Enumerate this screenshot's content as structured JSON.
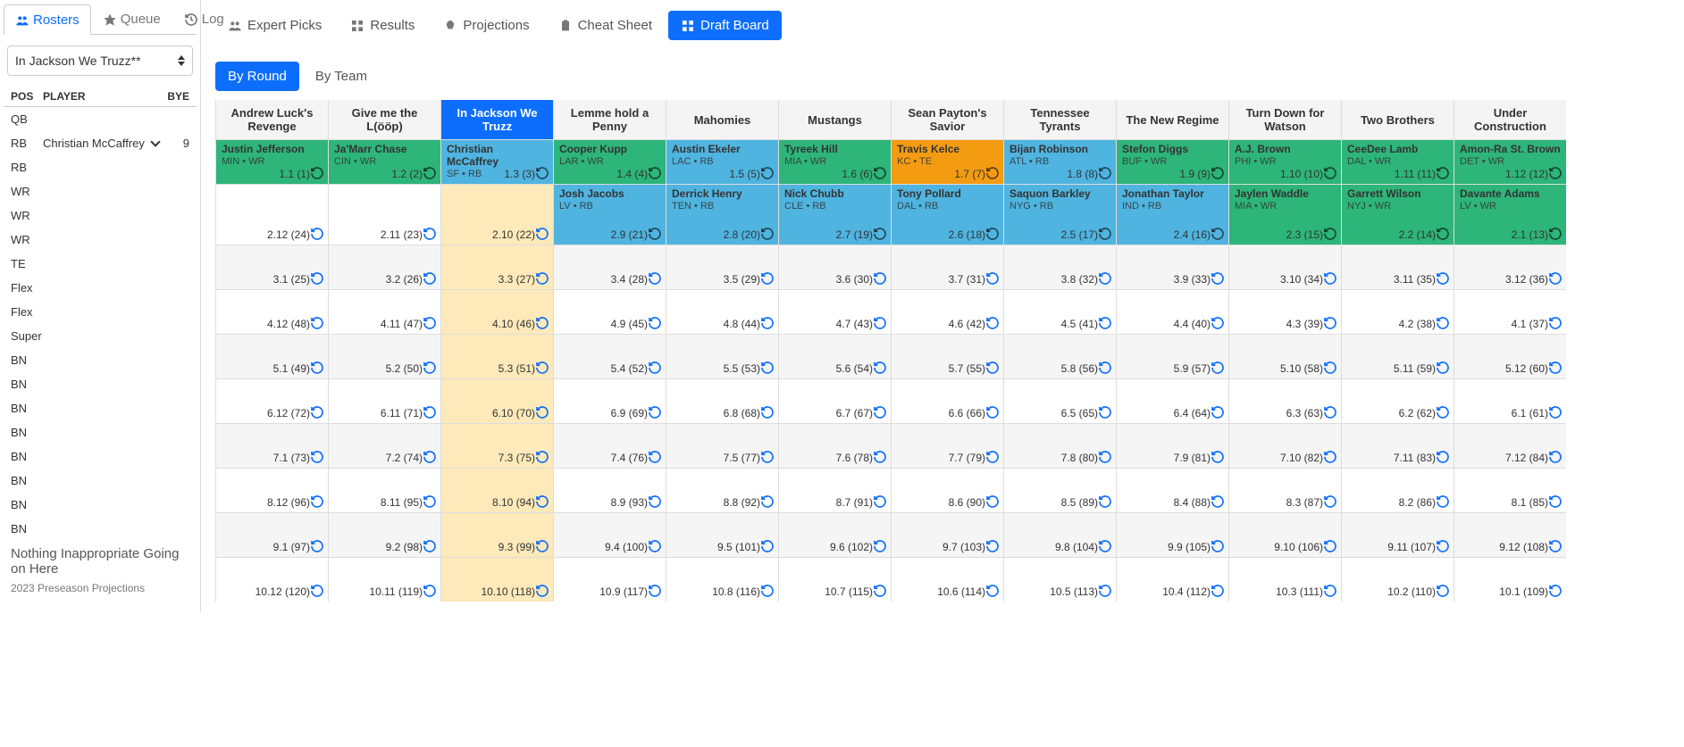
{
  "sidebar": {
    "tabs": [
      {
        "label": "Rosters",
        "active": true
      },
      {
        "label": "Queue",
        "active": false
      },
      {
        "label": "Log",
        "active": false
      }
    ],
    "team_selected": "In Jackson We Truzz**",
    "roster_header": {
      "pos": "POS",
      "player": "PLAYER",
      "bye": "BYE"
    },
    "roster": [
      {
        "pos": "QB",
        "player": "",
        "bye": ""
      },
      {
        "pos": "RB",
        "player": "Christian McCaffrey",
        "bye": "9",
        "caret": true
      },
      {
        "pos": "RB",
        "player": "",
        "bye": ""
      },
      {
        "pos": "WR",
        "player": "",
        "bye": ""
      },
      {
        "pos": "WR",
        "player": "",
        "bye": ""
      },
      {
        "pos": "WR",
        "player": "",
        "bye": ""
      },
      {
        "pos": "TE",
        "player": "",
        "bye": ""
      },
      {
        "pos": "Flex",
        "player": "",
        "bye": ""
      },
      {
        "pos": "Flex",
        "player": "",
        "bye": ""
      },
      {
        "pos": "Super",
        "player": "",
        "bye": ""
      },
      {
        "pos": "BN",
        "player": "",
        "bye": ""
      },
      {
        "pos": "BN",
        "player": "",
        "bye": ""
      },
      {
        "pos": "BN",
        "player": "",
        "bye": ""
      },
      {
        "pos": "BN",
        "player": "",
        "bye": ""
      },
      {
        "pos": "BN",
        "player": "",
        "bye": ""
      },
      {
        "pos": "BN",
        "player": "",
        "bye": ""
      },
      {
        "pos": "BN",
        "player": "",
        "bye": ""
      },
      {
        "pos": "BN",
        "player": "",
        "bye": ""
      }
    ],
    "subtext": "Nothing Inappropriate Going on Here",
    "projections_label": "2023 Preseason Projections"
  },
  "topnav": [
    {
      "label": "Expert Picks",
      "icon": "people"
    },
    {
      "label": "Results",
      "icon": "grid"
    },
    {
      "label": "Projections",
      "icon": "bulb"
    },
    {
      "label": "Cheat Sheet",
      "icon": "clipboard"
    },
    {
      "label": "Draft Board",
      "icon": "grid",
      "active": true
    }
  ],
  "toggle": [
    {
      "label": "By Round",
      "active": true
    },
    {
      "label": "By Team",
      "active": false
    }
  ],
  "teams": [
    "Andrew Luck's Revenge",
    "Give me the L(ööp)",
    "In Jackson We Truzz",
    "Lemme hold a Penny",
    "Mahomies",
    "Mustangs",
    "Sean Payton's Savior",
    "Tennessee Tyrants",
    "The New Regime",
    "Turn Down for Watson",
    "Two Brothers",
    "Under Construction"
  ],
  "active_team_index": 2,
  "picks": {
    "0_0": {
      "player": "Justin Jefferson",
      "sub": "MIN • WR",
      "pick": "1.1 (1)",
      "pos": "wr"
    },
    "0_1": {
      "player": "Ja'Marr Chase",
      "sub": "CIN • WR",
      "pick": "1.2 (2)",
      "pos": "wr"
    },
    "0_2": {
      "player": "Christian McCaffrey",
      "sub": "SF • RB",
      "pick": "1.3 (3)",
      "pos": "rb"
    },
    "0_3": {
      "player": "Cooper Kupp",
      "sub": "LAR • WR",
      "pick": "1.4 (4)",
      "pos": "wr"
    },
    "0_4": {
      "player": "Austin Ekeler",
      "sub": "LAC • RB",
      "pick": "1.5 (5)",
      "pos": "rb"
    },
    "0_5": {
      "player": "Tyreek Hill",
      "sub": "MIA • WR",
      "pick": "1.6 (6)",
      "pos": "wr"
    },
    "0_6": {
      "player": "Travis Kelce",
      "sub": "KC • TE",
      "pick": "1.7 (7)",
      "pos": "te"
    },
    "0_7": {
      "player": "Bijan Robinson",
      "sub": "ATL • RB",
      "pick": "1.8 (8)",
      "pos": "rb"
    },
    "0_8": {
      "player": "Stefon Diggs",
      "sub": "BUF • WR",
      "pick": "1.9 (9)",
      "pos": "wr"
    },
    "0_9": {
      "player": "A.J. Brown",
      "sub": "PHI • WR",
      "pick": "1.10 (10)",
      "pos": "wr"
    },
    "0_10": {
      "player": "CeeDee Lamb",
      "sub": "DAL • WR",
      "pick": "1.11 (11)",
      "pos": "wr"
    },
    "0_11": {
      "player": "Amon-Ra St. Brown",
      "sub": "DET • WR",
      "pick": "1.12 (12)",
      "pos": "wr"
    },
    "1_0": {
      "player": "",
      "sub": "",
      "pick": "2.12 (24)",
      "pos": ""
    },
    "1_1": {
      "player": "",
      "sub": "",
      "pick": "2.11 (23)",
      "pos": ""
    },
    "1_2": {
      "player": "",
      "sub": "",
      "pick": "2.10 (22)",
      "pos": ""
    },
    "1_3": {
      "player": "Josh Jacobs",
      "sub": "LV • RB",
      "pick": "2.9 (21)",
      "pos": "rb"
    },
    "1_4": {
      "player": "Derrick Henry",
      "sub": "TEN • RB",
      "pick": "2.8 (20)",
      "pos": "rb"
    },
    "1_5": {
      "player": "Nick Chubb",
      "sub": "CLE • RB",
      "pick": "2.7 (19)",
      "pos": "rb"
    },
    "1_6": {
      "player": "Tony Pollard",
      "sub": "DAL • RB",
      "pick": "2.6 (18)",
      "pos": "rb"
    },
    "1_7": {
      "player": "Saquon Barkley",
      "sub": "NYG • RB",
      "pick": "2.5 (17)",
      "pos": "rb"
    },
    "1_8": {
      "player": "Jonathan Taylor",
      "sub": "IND • RB",
      "pick": "2.4 (16)",
      "pos": "rb"
    },
    "1_9": {
      "player": "Jaylen Waddle",
      "sub": "MIA • WR",
      "pick": "2.3 (15)",
      "pos": "wr"
    },
    "1_10": {
      "player": "Garrett Wilson",
      "sub": "NYJ • WR",
      "pick": "2.2 (14)",
      "pos": "wr"
    },
    "1_11": {
      "player": "Davante Adams",
      "sub": "LV • WR",
      "pick": "2.1 (13)",
      "pos": "wr"
    },
    "2_0": {
      "pick": "3.1 (25)"
    },
    "2_1": {
      "pick": "3.2 (26)"
    },
    "2_2": {
      "pick": "3.3 (27)"
    },
    "2_3": {
      "pick": "3.4 (28)"
    },
    "2_4": {
      "pick": "3.5 (29)"
    },
    "2_5": {
      "pick": "3.6 (30)"
    },
    "2_6": {
      "pick": "3.7 (31)"
    },
    "2_7": {
      "pick": "3.8 (32)"
    },
    "2_8": {
      "pick": "3.9 (33)"
    },
    "2_9": {
      "pick": "3.10 (34)"
    },
    "2_10": {
      "pick": "3.11 (35)"
    },
    "2_11": {
      "pick": "3.12 (36)"
    },
    "3_0": {
      "pick": "4.12 (48)"
    },
    "3_1": {
      "pick": "4.11 (47)"
    },
    "3_2": {
      "pick": "4.10 (46)"
    },
    "3_3": {
      "pick": "4.9 (45)"
    },
    "3_4": {
      "pick": "4.8 (44)"
    },
    "3_5": {
      "pick": "4.7 (43)"
    },
    "3_6": {
      "pick": "4.6 (42)"
    },
    "3_7": {
      "pick": "4.5 (41)"
    },
    "3_8": {
      "pick": "4.4 (40)"
    },
    "3_9": {
      "pick": "4.3 (39)"
    },
    "3_10": {
      "pick": "4.2 (38)"
    },
    "3_11": {
      "pick": "4.1 (37)"
    },
    "4_0": {
      "pick": "5.1 (49)"
    },
    "4_1": {
      "pick": "5.2 (50)"
    },
    "4_2": {
      "pick": "5.3 (51)"
    },
    "4_3": {
      "pick": "5.4 (52)"
    },
    "4_4": {
      "pick": "5.5 (53)"
    },
    "4_5": {
      "pick": "5.6 (54)"
    },
    "4_6": {
      "pick": "5.7 (55)"
    },
    "4_7": {
      "pick": "5.8 (56)"
    },
    "4_8": {
      "pick": "5.9 (57)"
    },
    "4_9": {
      "pick": "5.10 (58)"
    },
    "4_10": {
      "pick": "5.11 (59)"
    },
    "4_11": {
      "pick": "5.12 (60)"
    },
    "5_0": {
      "pick": "6.12 (72)"
    },
    "5_1": {
      "pick": "6.11 (71)"
    },
    "5_2": {
      "pick": "6.10 (70)"
    },
    "5_3": {
      "pick": "6.9 (69)"
    },
    "5_4": {
      "pick": "6.8 (68)"
    },
    "5_5": {
      "pick": "6.7 (67)"
    },
    "5_6": {
      "pick": "6.6 (66)"
    },
    "5_7": {
      "pick": "6.5 (65)"
    },
    "5_8": {
      "pick": "6.4 (64)"
    },
    "5_9": {
      "pick": "6.3 (63)"
    },
    "5_10": {
      "pick": "6.2 (62)"
    },
    "5_11": {
      "pick": "6.1 (61)"
    },
    "6_0": {
      "pick": "7.1 (73)"
    },
    "6_1": {
      "pick": "7.2 (74)"
    },
    "6_2": {
      "pick": "7.3 (75)"
    },
    "6_3": {
      "pick": "7.4 (76)"
    },
    "6_4": {
      "pick": "7.5 (77)"
    },
    "6_5": {
      "pick": "7.6 (78)"
    },
    "6_6": {
      "pick": "7.7 (79)"
    },
    "6_7": {
      "pick": "7.8 (80)"
    },
    "6_8": {
      "pick": "7.9 (81)"
    },
    "6_9": {
      "pick": "7.10 (82)"
    },
    "6_10": {
      "pick": "7.11 (83)"
    },
    "6_11": {
      "pick": "7.12 (84)"
    },
    "7_0": {
      "pick": "8.12 (96)"
    },
    "7_1": {
      "pick": "8.11 (95)"
    },
    "7_2": {
      "pick": "8.10 (94)"
    },
    "7_3": {
      "pick": "8.9 (93)"
    },
    "7_4": {
      "pick": "8.8 (92)"
    },
    "7_5": {
      "pick": "8.7 (91)"
    },
    "7_6": {
      "pick": "8.6 (90)"
    },
    "7_7": {
      "pick": "8.5 (89)"
    },
    "7_8": {
      "pick": "8.4 (88)"
    },
    "7_9": {
      "pick": "8.3 (87)"
    },
    "7_10": {
      "pick": "8.2 (86)"
    },
    "7_11": {
      "pick": "8.1 (85)"
    },
    "8_0": {
      "pick": "9.1 (97)"
    },
    "8_1": {
      "pick": "9.2 (98)"
    },
    "8_2": {
      "pick": "9.3 (99)"
    },
    "8_3": {
      "pick": "9.4 (100)"
    },
    "8_4": {
      "pick": "9.5 (101)"
    },
    "8_5": {
      "pick": "9.6 (102)"
    },
    "8_6": {
      "pick": "9.7 (103)"
    },
    "8_7": {
      "pick": "9.8 (104)"
    },
    "8_8": {
      "pick": "9.9 (105)"
    },
    "8_9": {
      "pick": "9.10 (106)"
    },
    "8_10": {
      "pick": "9.11 (107)"
    },
    "8_11": {
      "pick": "9.12 (108)"
    },
    "9_0": {
      "pick": "10.12 (120)"
    },
    "9_1": {
      "pick": "10.11 (119)"
    },
    "9_2": {
      "pick": "10.10 (118)"
    },
    "9_3": {
      "pick": "10.9 (117)"
    },
    "9_4": {
      "pick": "10.8 (116)"
    },
    "9_5": {
      "pick": "10.7 (115)"
    },
    "9_6": {
      "pick": "10.6 (114)"
    },
    "9_7": {
      "pick": "10.5 (113)"
    },
    "9_8": {
      "pick": "10.4 (112)"
    },
    "9_9": {
      "pick": "10.3 (111)"
    },
    "9_10": {
      "pick": "10.2 (110)"
    },
    "9_11": {
      "pick": "10.1 (109)"
    }
  },
  "total_rounds": 10
}
